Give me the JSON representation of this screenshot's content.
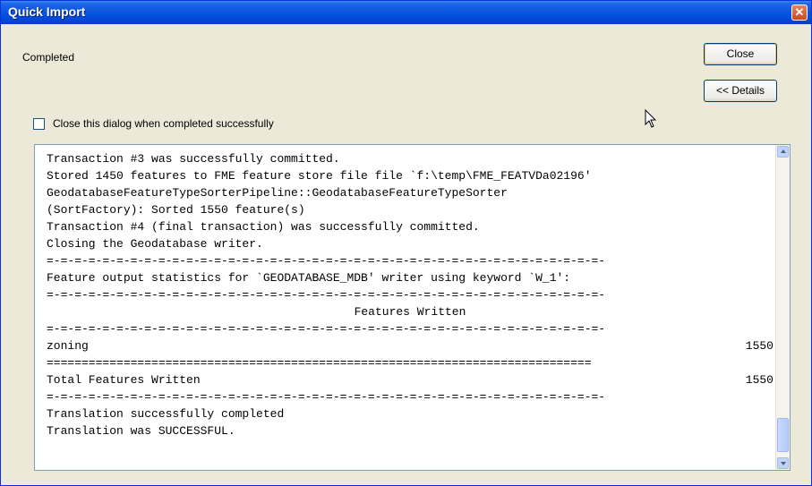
{
  "window": {
    "title": "Quick Import",
    "close_glyph": "✕"
  },
  "status": {
    "text": "Completed"
  },
  "buttons": {
    "close_label": "Close",
    "details_label": "<< Details"
  },
  "checkbox": {
    "label": "Close this dialog when completed successfully",
    "checked": false
  },
  "log": {
    "lines": [
      "Transaction #3 was successfully committed.",
      "Stored 1450 features to FME feature store file file `f:\\temp\\FME_FEATVDa02196'",
      "GeodatabaseFeatureTypeSorterPipeline::GeodatabaseFeatureTypeSorter",
      "(SortFactory): Sorted 1550 feature(s)",
      "Transaction #4 (final transaction) was successfully committed.",
      "Closing the Geodatabase writer."
    ],
    "separator_dash": "=-=-=-=-=-=-=-=-=-=-=-=-=-=-=-=-=-=-=-=-=-=-=-=-=-=-=-=-=-=-=-=-=-=-=-=-=-=-=-=-",
    "separator_eq": "==============================================================================",
    "stats_header": "Feature output statistics for `GEODATABASE_MDB' writer using keyword `W_1':",
    "features_written_heading": "Features Written",
    "feature_rows": [
      {
        "name": "zoning",
        "count": "1550"
      }
    ],
    "total_label": "Total Features Written",
    "total_count": "1550",
    "final_lines": [
      "Translation successfully completed",
      "Translation was SUCCESSFUL."
    ]
  },
  "icons": {
    "cursor": "arrow-cursor-icon"
  }
}
